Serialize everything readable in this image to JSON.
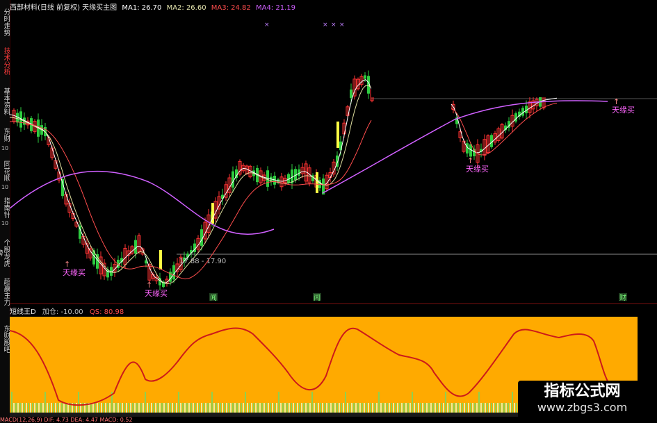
{
  "sidebar": {
    "tabs": [
      {
        "label": "分时走势",
        "num": ""
      },
      {
        "label": "技术分析",
        "num": "",
        "active": true
      },
      {
        "label": "基本资料",
        "num": ""
      },
      {
        "label": "东财",
        "num": "10"
      },
      {
        "label": "同花顺",
        "num": "10"
      },
      {
        "label": "指南针",
        "num": "10"
      },
      {
        "label": "个股龙虎榜",
        "num": ""
      },
      {
        "label": "超赢主力",
        "num": ""
      },
      {
        "label": "东财股吧",
        "num": ""
      }
    ]
  },
  "header": {
    "title": "西部材料(日线 前复权) 天缘买主图",
    "ma1": "MA1: 26.70",
    "ma2": "MA2: 26.60",
    "ma3": "MA3: 24.82",
    "ma4": "MA4: 21.19"
  },
  "colors": {
    "ma1": "#ffffff",
    "ma2": "#e0e0a0",
    "ma3": "#ff4d4d",
    "ma4": "#d060ff",
    "up": "#ff3333",
    "down": "#2ecc40",
    "signal": "#ff66ff",
    "indicator_bg": "#ffaa00",
    "indicator_line": "#cc1a1a"
  },
  "signals": [
    {
      "label": "天缘买"
    },
    {
      "label": "天缘买"
    },
    {
      "label": "天缘买"
    },
    {
      "label": "天缘买"
    }
  ],
  "price_range": "17.88 - 17.90",
  "event_markers": [
    "闻",
    "闻",
    "财"
  ],
  "indicator": {
    "name": "短线王D",
    "add": "加仓: -10.00",
    "qs": "QS: 80.98"
  },
  "bottom_text": "MACD(12,26,9) DIF: 4.73 DEA: 4.47 MACD: 0.52",
  "watermark": {
    "title": "指标公式网",
    "url": "www.zbgs3.com"
  }
}
